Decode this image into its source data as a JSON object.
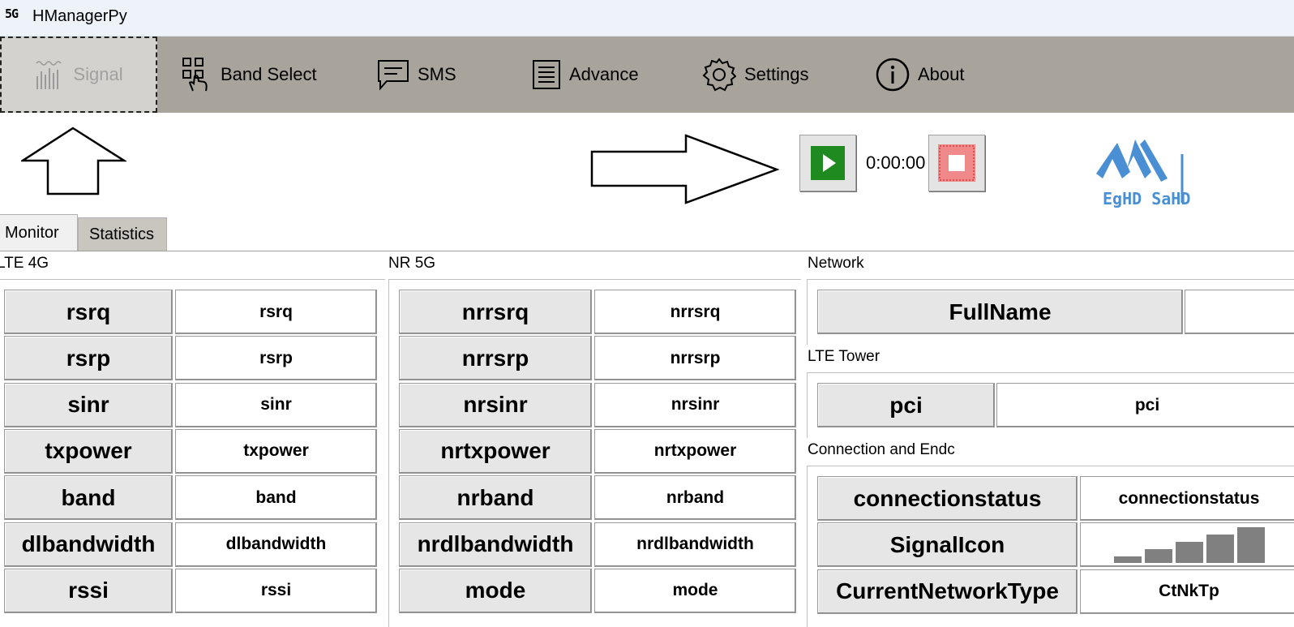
{
  "window": {
    "icon_text": "5G",
    "title": "HManagerPy"
  },
  "toolbar": {
    "items": [
      {
        "label": "Signal",
        "icon": "signal-icon",
        "active": true
      },
      {
        "label": "Band Select",
        "icon": "band-select-icon"
      },
      {
        "label": "SMS",
        "icon": "sms-icon"
      },
      {
        "label": "Advance",
        "icon": "advance-icon"
      },
      {
        "label": "Settings",
        "icon": "settings-icon"
      },
      {
        "label": "About",
        "icon": "about-icon"
      }
    ]
  },
  "controls": {
    "timer": "0:00:00",
    "play_icon": "play-icon",
    "stop_icon": "stop-icon"
  },
  "logo": {
    "text": "EgHD SaHD",
    "color": "#4a8fd4"
  },
  "tabs": {
    "monitor": "Monitor",
    "statistics": "Statistics"
  },
  "lte": {
    "title": "LTE 4G",
    "rows": [
      {
        "key": "rsrq",
        "value": "rsrq"
      },
      {
        "key": "rsrp",
        "value": "rsrp"
      },
      {
        "key": "sinr",
        "value": "sinr"
      },
      {
        "key": "txpower",
        "value": "txpower"
      },
      {
        "key": "band",
        "value": "band"
      },
      {
        "key": "dlbandwidth",
        "value": "dlbandwidth"
      },
      {
        "key": "rssi",
        "value": "rssi"
      }
    ]
  },
  "nr": {
    "title": "NR 5G",
    "rows": [
      {
        "key": "nrrsrq",
        "value": "nrrsrq"
      },
      {
        "key": "nrrsrp",
        "value": "nrrsrp"
      },
      {
        "key": "nrsinr",
        "value": "nrsinr"
      },
      {
        "key": "nrtxpower",
        "value": "nrtxpower"
      },
      {
        "key": "nrband",
        "value": "nrband"
      },
      {
        "key": "nrdlbandwidth",
        "value": "nrdlbandwidth"
      },
      {
        "key": "mode",
        "value": "mode"
      }
    ]
  },
  "network": {
    "title": "Network",
    "fullname_key": "FullName",
    "fullname_value": "",
    "lte_tower_title": "LTE Tower",
    "pci_key": "pci",
    "pci_value": "pci",
    "conn_title": "Connection and Endc",
    "conn_rows": [
      {
        "key": "connectionstatus",
        "value": "connectionstatus"
      },
      {
        "key": "SignalIcon",
        "value": ""
      },
      {
        "key": "CurrentNetworkType",
        "value": "CtNkTp"
      }
    ],
    "signal_level": 5,
    "signal_max": 5
  }
}
